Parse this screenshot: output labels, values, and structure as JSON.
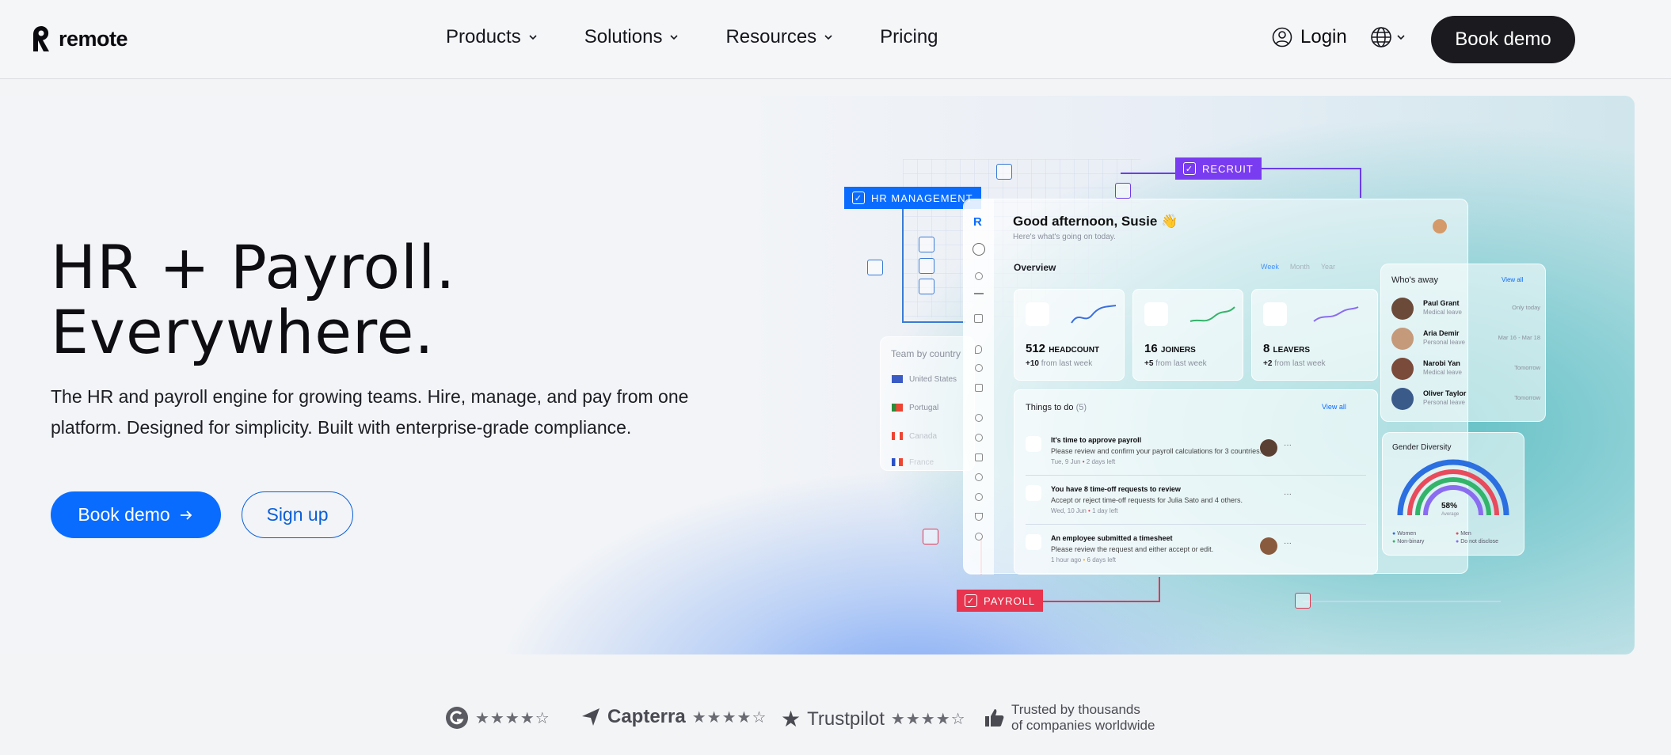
{
  "brand": {
    "name": "remote"
  },
  "nav": {
    "items": [
      {
        "label": "Products"
      },
      {
        "label": "Solutions"
      },
      {
        "label": "Resources"
      },
      {
        "label": "Pricing"
      }
    ],
    "login": "Login",
    "cta": "Book demo"
  },
  "hero": {
    "title_line1": "HR + Payroll.",
    "title_line2": "Everywhere.",
    "subtitle": "The HR and payroll engine for growing teams. Hire, manage, and pay from one platform. Designed for simplicity. Built with enterprise-grade compliance.",
    "primary_cta": "Book demo",
    "secondary_cta": "Sign up"
  },
  "mockup": {
    "tags": {
      "hr": "HR MANAGEMENT",
      "recruit": "RECRUIT",
      "payroll": "PAYROLL"
    },
    "greeting": "Good afternoon, Susie 👋",
    "greeting_sub": "Here's what's going on today.",
    "overview": "Overview",
    "overview_tabs": [
      "Week",
      "Month",
      "Year"
    ],
    "stats": [
      {
        "value": "512",
        "label": "HEADCOUNT",
        "delta": "+10",
        "delta_text": "from last week"
      },
      {
        "value": "16",
        "label": "JOINERS",
        "delta": "+5",
        "delta_text": "from last week"
      },
      {
        "value": "8",
        "label": "LEAVERS",
        "delta": "+2",
        "delta_text": "from last week"
      }
    ],
    "team_by_country": {
      "title": "Team by country",
      "countries": [
        "United States",
        "Portugal",
        "Canada",
        "France"
      ]
    },
    "todo": {
      "title": "Things to do",
      "count": "(5)",
      "view_all": "View all",
      "items": [
        {
          "title": "It's time to approve payroll",
          "desc": "Please review and confirm your payroll calculations for 3 countries.",
          "date": "Tue, 9 Jun",
          "due": "2 days left"
        },
        {
          "title": "You have 8 time-off requests to review",
          "desc": "Accept or reject time-off requests for Julia Sato and 4 others.",
          "date": "Wed, 10 Jun",
          "due": "1 day left"
        },
        {
          "title": "An employee submitted a timesheet",
          "desc": "Please review the request and either accept or edit.",
          "date": "1 hour ago",
          "due": "6 days left"
        }
      ]
    },
    "whos_away": {
      "title": "Who's away",
      "view_all": "View all",
      "people": [
        {
          "name": "Paul Grant",
          "reason": "Medical leave",
          "when": "Only today"
        },
        {
          "name": "Aria Demir",
          "reason": "Personal leave",
          "when": "Mar 16 - Mar 18"
        },
        {
          "name": "Narobi Yan",
          "reason": "Medical leave",
          "when": "Tomorrow"
        },
        {
          "name": "Oliver Taylor",
          "reason": "Personal leave",
          "when": "Tomorrow"
        }
      ]
    },
    "gender_diversity": {
      "title": "Gender Diversity",
      "value": "58%",
      "value_label": "Average",
      "legend": [
        {
          "label": "Women",
          "color": "#2b6fe0"
        },
        {
          "label": "Men",
          "color": "#e84b5c"
        },
        {
          "label": "Non-binary",
          "color": "#34b36a"
        },
        {
          "label": "Do not disclose",
          "color": "#8a6cf0"
        }
      ]
    }
  },
  "trust": {
    "capterra": "Capterra",
    "trustpilot": "Trustpilot",
    "trusted_line1": "Trusted by thousands",
    "trusted_line2": "of companies worldwide"
  },
  "colors": {
    "primary": "#0a6cff",
    "dark": "#1b1b1f",
    "hr_tag": "#0a6cff",
    "recruit_tag": "#7a3cf0",
    "payroll_tag": "#e8344e"
  }
}
